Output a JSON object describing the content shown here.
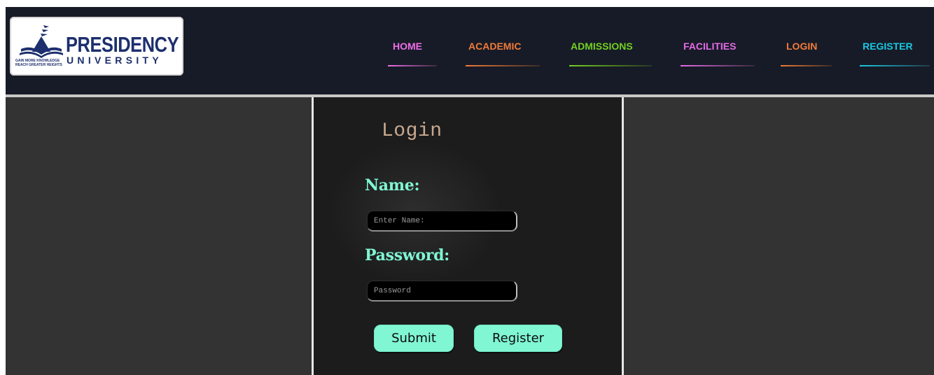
{
  "logo": {
    "title": "PRESIDENCY",
    "subtitle": "UNIVERSITY",
    "tagline_line1": "GAIN MORE KNOWLEDGE",
    "tagline_line2": "REACH GREATER HEIGHTS"
  },
  "nav": {
    "items": [
      {
        "label": "HOME",
        "color": "#ee6ee8"
      },
      {
        "label": "ACADEMIC",
        "color": "#f07b39"
      },
      {
        "label": "ADMISSIONS",
        "color": "#73d020"
      },
      {
        "label": "FACILITIES",
        "color": "#e46be6"
      },
      {
        "label": "LOGIN",
        "color": "#f07b39"
      },
      {
        "label": "REGISTER",
        "color": "#18c7e2"
      }
    ]
  },
  "login": {
    "title": "Login",
    "name_label": "Name:",
    "name_placeholder": "Enter Name:",
    "password_label": "Password:",
    "password_placeholder": "Password",
    "submit_label": "Submit",
    "register_label": "Register"
  },
  "colors": {
    "header_bg": "#171b27",
    "side_bg": "#333333",
    "panel_bg": "#1c1c1c",
    "accent": "#80f6d2",
    "title_color": "#c9a98f"
  }
}
